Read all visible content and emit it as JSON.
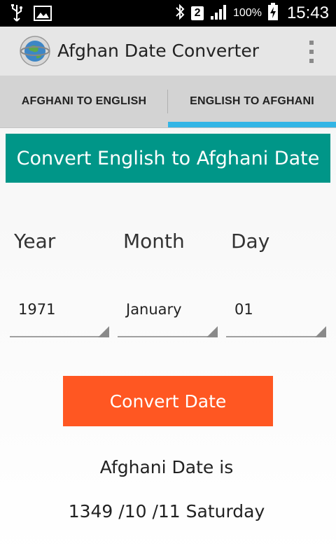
{
  "status_bar": {
    "battery_percent": "100%",
    "sim_slot": "2",
    "time": "15:43",
    "icons": [
      "usb-icon",
      "image-icon",
      "bluetooth-icon",
      "sim-2-icon",
      "signal-icon",
      "battery-charging-icon"
    ]
  },
  "action_bar": {
    "title": "Afghan Date Converter",
    "logo_icon": "globe-logo-icon",
    "menu_icon": "overflow-menu-icon"
  },
  "tabs": [
    {
      "label": "AFGHANI TO ENGLISH",
      "selected": false
    },
    {
      "label": "ENGLISH TO AFGHANI",
      "selected": true
    }
  ],
  "colors": {
    "banner": "#009688",
    "button": "#ff5722",
    "tab_indicator": "#33b5e5"
  },
  "form": {
    "header": "Convert English to Afghani Date",
    "labels": {
      "year": "Year",
      "month": "Month",
      "day": "Day"
    },
    "year_value": "1971",
    "month_value": "January",
    "day_value": "01",
    "convert_label": "Convert Date"
  },
  "result": {
    "label": "Afghani Date is",
    "value": "1349 /10 /11 Saturday"
  }
}
